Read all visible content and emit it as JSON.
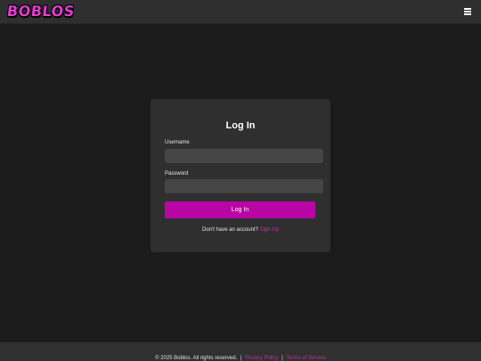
{
  "header": {
    "logo_text": "BOBLOS",
    "menu_icon": "hamburger-menu-icon"
  },
  "login": {
    "title": "Log In",
    "username_label": "Username",
    "username_value": "",
    "password_label": "Password",
    "password_value": "",
    "submit_label": "Log In",
    "signup_prompt": "Don't have an account?",
    "signup_link": "Sign Up"
  },
  "footer": {
    "copyright": "© 2025 Boblos. All rights reserved.",
    "separator": "|",
    "privacy_link": "Privacy Policy",
    "terms_link": "Terms of Service"
  },
  "colors": {
    "accent": "#b805a5",
    "logo": "#e43bd0",
    "background": "#1b1b1b",
    "panel": "#2f2f2f",
    "input": "#454545"
  }
}
